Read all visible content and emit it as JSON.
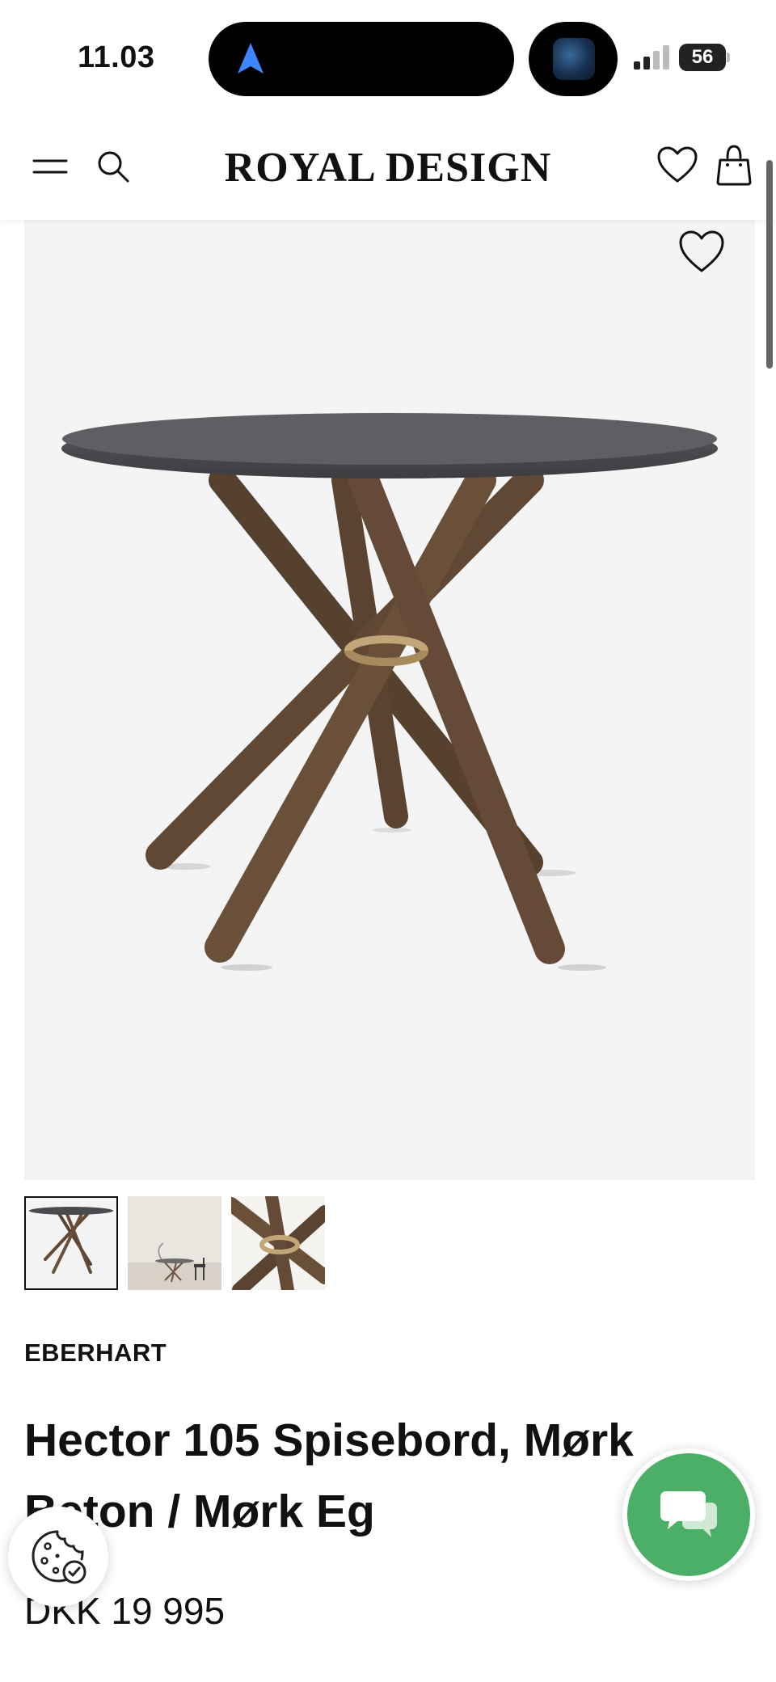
{
  "status_bar": {
    "time": "11.03",
    "battery": "56",
    "navigation_icon": "location-arrow-icon",
    "signal_icon": "cellular-signal-icon"
  },
  "header": {
    "logo": "ROYAL DESIGN",
    "icons": [
      "hamburger-menu-icon",
      "search-icon",
      "heart-icon",
      "shopping-bag-icon"
    ]
  },
  "gallery": {
    "selected_index": 0,
    "thumbnails": [
      "table-product-image",
      "table-room-scene",
      "leg-joint-detail"
    ],
    "favorite_icon": "heart-icon"
  },
  "product": {
    "brand": "EBERHART",
    "title": "Hector 105 Spisebord, Mørk Beton / Mørk Eg",
    "price": "DKK 19 995"
  },
  "floating": {
    "cookie_icon": "cookie-settings-icon",
    "chat_icon": "chat-bubbles-icon"
  },
  "colors": {
    "chat_green": "#4caf68",
    "tabletop": "#5a5b5e",
    "oak_dark": "#5b4330",
    "brass_ring": "#c2a678",
    "nav_blue": "#3d86ff"
  }
}
